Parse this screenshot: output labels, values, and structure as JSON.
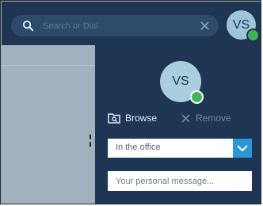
{
  "search": {
    "placeholder": "Search or Dial",
    "value": ""
  },
  "user": {
    "initials": "VS",
    "presence_color": "#43b35a"
  },
  "panel": {
    "browse_label": "Browse",
    "remove_label": "Remove",
    "status_value": "In the office",
    "message_placeholder": "Your personal message...",
    "message_value": ""
  },
  "colors": {
    "navy": "#1e3554",
    "accent_blue": "#2b97d6",
    "presence_green": "#43b35a"
  }
}
